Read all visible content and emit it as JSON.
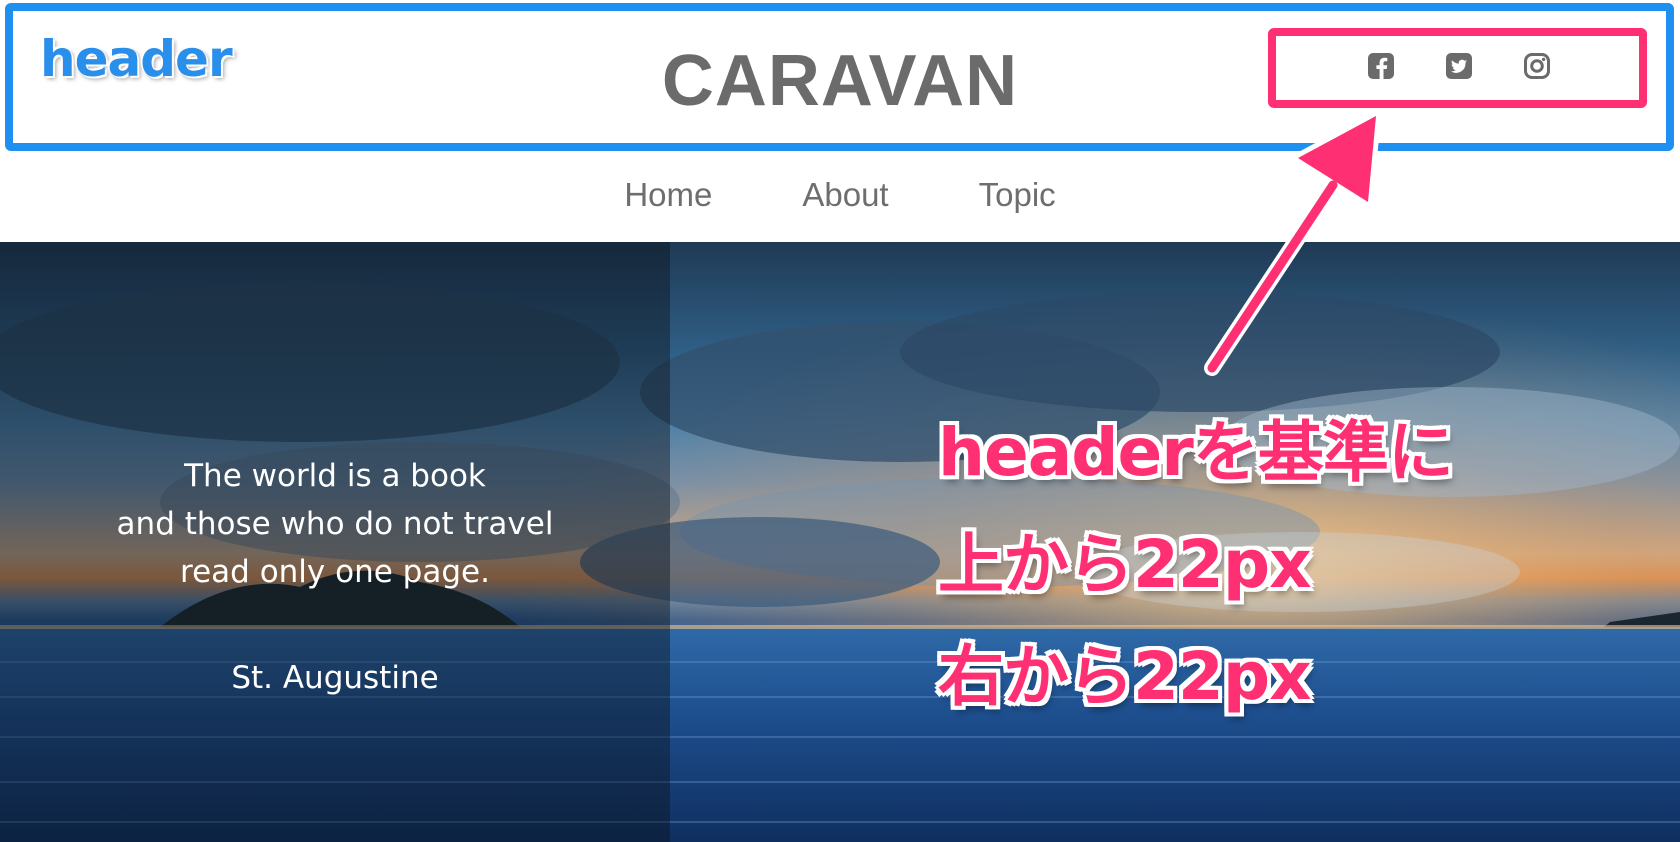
{
  "annotation_overlay": {
    "header_label": "header",
    "lines": [
      "headerを基準に",
      "上から22px",
      "右から22px"
    ]
  },
  "header": {
    "title": "CARAVAN",
    "social": [
      {
        "name": "facebook-icon"
      },
      {
        "name": "twitter-icon"
      },
      {
        "name": "instagram-icon"
      }
    ]
  },
  "nav": {
    "items": [
      {
        "label": "Home"
      },
      {
        "label": "About"
      },
      {
        "label": "Topic"
      }
    ]
  },
  "hero": {
    "quote_lines": [
      "The world is a book",
      "and those who do not travel",
      "read only one page."
    ],
    "author": "St. Augustine"
  },
  "colors": {
    "header_outline": "#2090f0",
    "highlight": "#ff2f73",
    "title": "#6b6b6b",
    "nav_text": "#6e6e6e"
  }
}
